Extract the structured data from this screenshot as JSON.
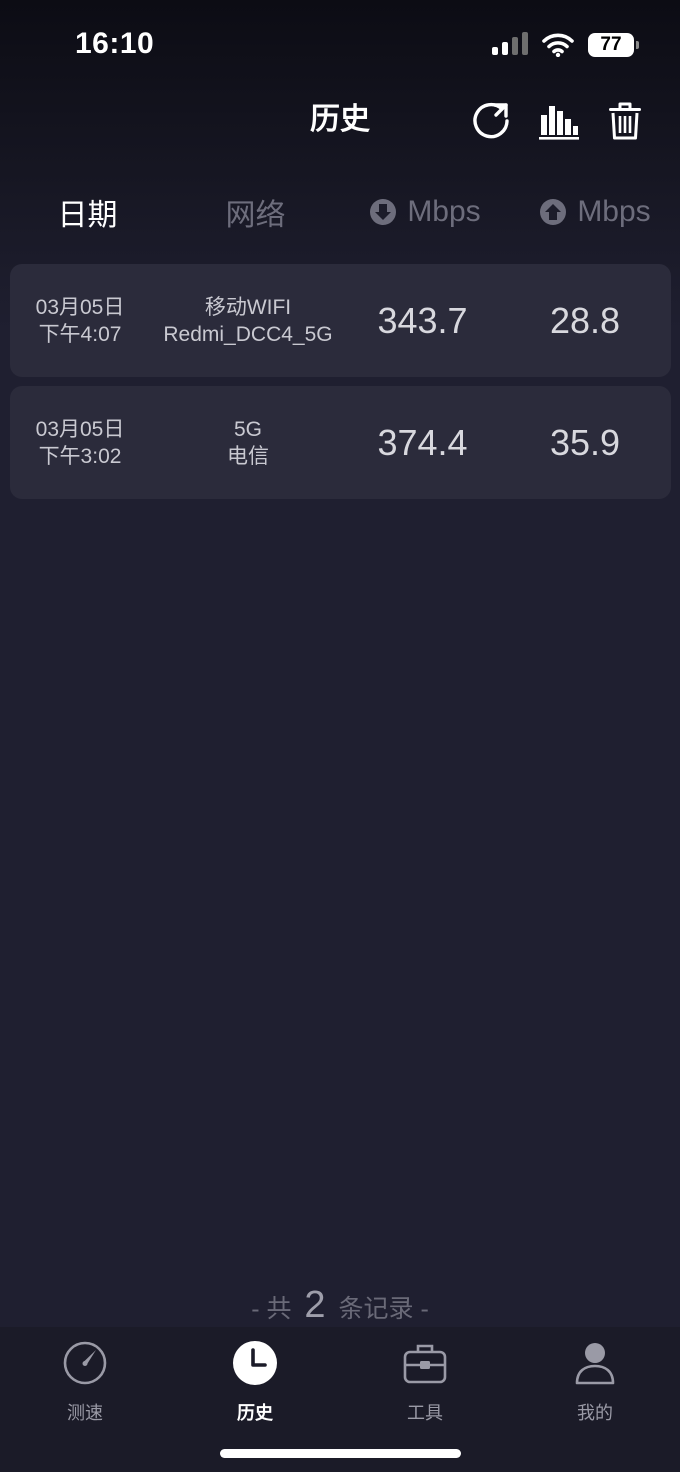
{
  "status_bar": {
    "time": "16:10",
    "battery": "77"
  },
  "header": {
    "title": "历史",
    "refresh_icon": "refresh-icon",
    "chart_icon": "bar-chart-icon",
    "delete_icon": "trash-icon"
  },
  "columns": {
    "date": "日期",
    "network": "网络",
    "download_unit": "Mbps",
    "upload_unit": "Mbps"
  },
  "records": [
    {
      "date": "03月05日",
      "time": "下午4:07",
      "network_type": "移动WIFI",
      "network_name": "Redmi_DCC4_5G",
      "download": "343.7",
      "upload": "28.8"
    },
    {
      "date": "03月05日",
      "time": "下午3:02",
      "network_type": "5G",
      "network_name": "电信",
      "download": "374.4",
      "upload": "35.9"
    }
  ],
  "footer": {
    "prefix": "- 共",
    "count": "2",
    "suffix": "条记录 -"
  },
  "tabs": [
    {
      "label": "测速",
      "icon": "speedometer-icon"
    },
    {
      "label": "历史",
      "icon": "clock-icon",
      "active": true
    },
    {
      "label": "工具",
      "icon": "toolbox-icon"
    },
    {
      "label": "我的",
      "icon": "user-icon"
    }
  ],
  "colors": {
    "background": "#1f1f30",
    "card": "#2b2b3b",
    "muted_text": "#6d6d7c",
    "tab_bar": "#1b1b28"
  }
}
